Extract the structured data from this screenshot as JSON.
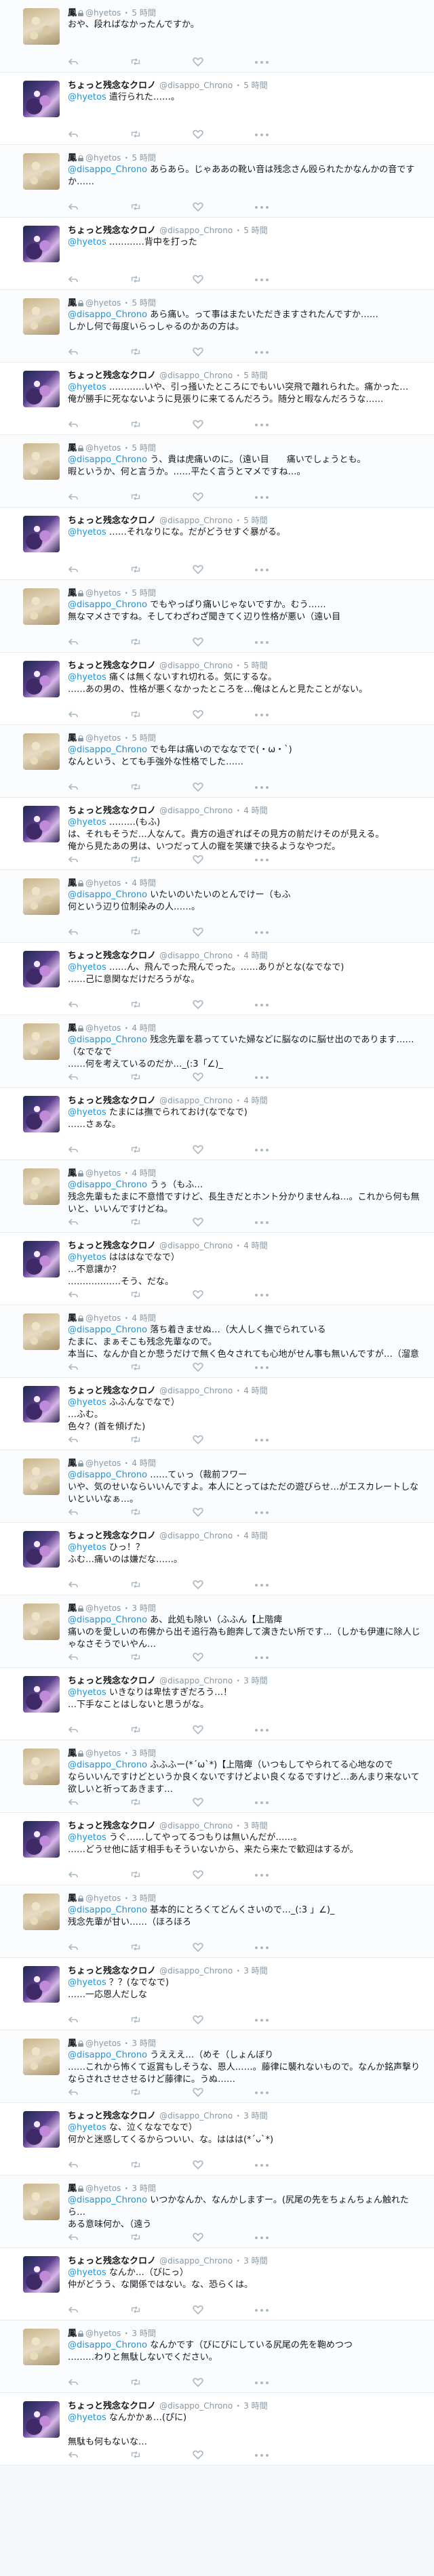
{
  "users": {
    "hyetos": {
      "display_name": "鳳",
      "screen_name": "@hyetos",
      "avatar": "hyetos-avatar"
    },
    "chrono": {
      "display_name": "ちょっと残念なクロノ",
      "screen_name": "@disappo_Chrono",
      "avatar": "chrono-avatar"
    }
  },
  "separator": "・",
  "icons": [
    "reply-icon",
    "retweet-icon",
    "like-icon",
    "more-icon",
    "lock-icon"
  ],
  "colors": {
    "link": "#1b95e0",
    "meta": "#8899a6",
    "divider": "#e6ecf0"
  },
  "tweets": [
    {
      "user": "hyetos",
      "display_name": "鳳",
      "locked": true,
      "screen_name": "@hyetos",
      "time": "5 時間",
      "mention": "",
      "text": "おや、段ればなかったんですか。"
    },
    {
      "user": "chrono",
      "display_name": "ちょっと残念なクロノ",
      "locked": false,
      "screen_name": "@disappo_Chrono",
      "time": "5 時間",
      "mention": "@hyetos",
      "text": " 遣行られた……。"
    },
    {
      "user": "hyetos",
      "display_name": "鳳",
      "locked": true,
      "screen_name": "@hyetos",
      "time": "5 時間",
      "mention": "@disappo_Chrono",
      "text": " あらあら。じゃああの靴い音は残念さん殴られたかなんかの音ですか……"
    },
    {
      "user": "chrono",
      "display_name": "ちょっと残念なクロノ",
      "locked": false,
      "screen_name": "@disappo_Chrono",
      "time": "5 時間",
      "mention": "@hyetos",
      "text": " …………背中を打った"
    },
    {
      "user": "hyetos",
      "display_name": "鳳",
      "locked": true,
      "screen_name": "@hyetos",
      "time": "5 時間",
      "mention": "@disappo_Chrono",
      "text": " あら痛い。って事はまたいただきますされたんですか……\nしかし何で毎度いらっしゃるのかあの方は。"
    },
    {
      "user": "chrono",
      "display_name": "ちょっと残念なクロノ",
      "locked": false,
      "screen_name": "@disappo_Chrono",
      "time": "5 時間",
      "mention": "@hyetos",
      "text": " …………いや、引っ掻いたところにでもいい突飛で離れられた。痛かった…\n俺が勝手に死なないように見張りに来てるんだろう。随分と暇なんだろうな……"
    },
    {
      "user": "hyetos",
      "display_name": "鳳",
      "locked": true,
      "screen_name": "@hyetos",
      "time": "5 時間",
      "mention": "@disappo_Chrono",
      "text": " う、貴は虎痛いのに。（遠い目　　痛いでしょうとも。\n暇というか、何と言うか。……平たく言うとマメですね…。"
    },
    {
      "user": "chrono",
      "display_name": "ちょっと残念なクロノ",
      "locked": false,
      "screen_name": "@disappo_Chrono",
      "time": "5 時間",
      "mention": "@hyetos",
      "text": " ……それなりにな。だがどうせすぐ暴がる。"
    },
    {
      "user": "hyetos",
      "display_name": "鳳",
      "locked": true,
      "screen_name": "@hyetos",
      "time": "5 時間",
      "mention": "@disappo_Chrono",
      "text": " でもやっぱり痛いじゃないですか。むう……\n無なマメさですね。そしてわざわざ聞きてく辺り性格が悪い（遠い目"
    },
    {
      "user": "chrono",
      "display_name": "ちょっと残念なクロノ",
      "locked": false,
      "screen_name": "@disappo_Chrono",
      "time": "5 時間",
      "mention": "@hyetos",
      "text": " 痛くは無くないすれ切れる。気にするな。\n……あの男の、性格が悪くなかったところを…俺はとんと見たことがない。"
    },
    {
      "user": "hyetos",
      "display_name": "鳳",
      "locked": true,
      "screen_name": "@hyetos",
      "time": "5 時間",
      "mention": "@disappo_Chrono",
      "text": " でも年は痛いのでななでで(・ω・`)\nなんという、とても手強外な性格でした……"
    },
    {
      "user": "chrono",
      "display_name": "ちょっと残念なクロノ",
      "locked": false,
      "screen_name": "@disappo_Chrono",
      "time": "4 時間",
      "mention": "@hyetos",
      "text": " ………(もふ)\nは、それもそうだ…人なんて。貴方の過ぎればその見方の前だけそのが見える。\n俺から見たあの男は、いつだって人の寵を笑嫌で抉るようなやつだ。"
    },
    {
      "user": "hyetos",
      "display_name": "鳳",
      "locked": true,
      "screen_name": "@hyetos",
      "time": "4 時間",
      "mention": "@disappo_Chrono",
      "text": " いたいのいたいのとんでけー（もふ\n何という辺り位制染みの人……。"
    },
    {
      "user": "chrono",
      "display_name": "ちょっと残念なクロノ",
      "locked": false,
      "screen_name": "@disappo_Chrono",
      "time": "4 時間",
      "mention": "@hyetos",
      "text": " ……ん、飛んでった飛んでった。……ありがとな(なでなで)\n……己に意関なだけだろうがな。"
    },
    {
      "user": "hyetos",
      "display_name": "鳳",
      "locked": true,
      "screen_name": "@hyetos",
      "time": "4 時間",
      "mention": "@disappo_Chrono",
      "text": " 残念先輩を慕ってていた婦などに脳なのに脳せ出のであります……（なでなで\n……何を考えているのだか…_(:3「∠)_"
    },
    {
      "user": "chrono",
      "display_name": "ちょっと残念なクロノ",
      "locked": false,
      "screen_name": "@disappo_Chrono",
      "time": "4 時間",
      "mention": "@hyetos",
      "text": " たまには撫でられておけ(なでなで)\n……さぁな。"
    },
    {
      "user": "hyetos",
      "display_name": "鳳",
      "locked": true,
      "screen_name": "@hyetos",
      "time": "4 時間",
      "mention": "@disappo_Chrono",
      "text": " うぅ（もふ…\n残念先輩もたまに不意惜ですけど、長生きだとホント分かりませんね…。これから何も無いと、いいんですけどね。"
    },
    {
      "user": "chrono",
      "display_name": "ちょっと残念なクロノ",
      "locked": false,
      "screen_name": "@disappo_Chrono",
      "time": "4 時間",
      "mention": "@hyetos",
      "text": " はははなでなで）\n…不意讓か？\n………………そう、だな。"
    },
    {
      "user": "hyetos",
      "display_name": "鳳",
      "locked": true,
      "screen_name": "@hyetos",
      "time": "4 時間",
      "mention": "@disappo_Chrono",
      "text": " 落ち着きませぬ…（大人しく撫でられている\nたまに、まぁそこも残念先輩なので。\n本当に、なんか自とか悲うだけで無く色々されても心地がせん事も無いんですが…（溜意"
    },
    {
      "user": "chrono",
      "display_name": "ちょっと残念なクロノ",
      "locked": false,
      "screen_name": "@disappo_Chrono",
      "time": "4 時間",
      "mention": "@hyetos",
      "text": " ふふんなでなで）\n…ふむ。\n色々？(首を傾げた)"
    },
    {
      "user": "hyetos",
      "display_name": "鳳",
      "locked": true,
      "screen_name": "@hyetos",
      "time": "4 時間",
      "mention": "@disappo_Chrono",
      "text": " ……てぃっ（裁前フワー\nいや、気のせいならいいんですよ。本人にとってはただの遊びらせ…がエスカレートしないといいなぁ…。"
    },
    {
      "user": "chrono",
      "display_name": "ちょっと残念なクロノ",
      "locked": false,
      "screen_name": "@disappo_Chrono",
      "time": "4 時間",
      "mention": "@hyetos",
      "text": " ひっ！？\nふむ…痛いのは嫌だな……。"
    },
    {
      "user": "hyetos",
      "display_name": "鳳",
      "locked": true,
      "screen_name": "@hyetos",
      "time": "3 時間",
      "mention": "@disappo_Chrono",
      "text": " あ、此処も除い（ふふん【上階痺\n痛いのを愛しいの布佛から出そ追行為も飽奔して演きたい所です…（しかも伊連に除人じゃなさそうでいやん…"
    },
    {
      "user": "chrono",
      "display_name": "ちょっと残念なクロノ",
      "locked": false,
      "screen_name": "@disappo_Chrono",
      "time": "3 時間",
      "mention": "@hyetos",
      "text": " いきなりは卑怯すぎだろう…！\n…下手なことはしないと思うがな。"
    },
    {
      "user": "hyetos",
      "display_name": "鳳",
      "locked": true,
      "screen_name": "@hyetos",
      "time": "3 時間",
      "mention": "@disappo_Chrono",
      "text": " ふふふー(*´ω`*)【上階痺（いつもしてやられてる心地なので\nならいいんですけどというか良くないですけどよい良くなるですけど…あんまり来ないて欲しいと祈ってあきます…"
    },
    {
      "user": "chrono",
      "display_name": "ちょっと残念なクロノ",
      "locked": false,
      "screen_name": "@disappo_Chrono",
      "time": "3 時間",
      "mention": "@hyetos",
      "text": " うぐ……してやってるつもりは無いんだが……。\n……どうせ他に話す相手もそういないから、来たら来たで歓迎はするが。"
    },
    {
      "user": "hyetos",
      "display_name": "鳳",
      "locked": true,
      "screen_name": "@hyetos",
      "time": "3 時間",
      "mention": "@disappo_Chrono",
      "text": " 基本的にとろくてどんくさいので…_(:3 」∠)_\n残念先輩が甘い……（ほろほろ"
    },
    {
      "user": "chrono",
      "display_name": "ちょっと残念なクロノ",
      "locked": false,
      "screen_name": "@disappo_Chrono",
      "time": "3 時間",
      "mention": "@hyetos",
      "text": " ？？(なでなで)\n……一応恩人だしな"
    },
    {
      "user": "hyetos",
      "display_name": "鳳",
      "locked": true,
      "screen_name": "@hyetos",
      "time": "3 時間",
      "mention": "@disappo_Chrono",
      "text": " うえええ…（めそ（しょんぼり\n……これから怖くて返賞もしそうな、恩人……。藤律に襲れないもので。なんか銘声撃りならされさせさせるけど藤律に。うぬ……"
    },
    {
      "user": "chrono",
      "display_name": "ちょっと残念なクロノ",
      "locked": false,
      "screen_name": "@disappo_Chrono",
      "time": "3 時間",
      "mention": "@hyetos",
      "text": " な、泣くななでなで）\n何かと迷惑してくるからついい、な。ははは(*´ᴗ`*)"
    },
    {
      "user": "hyetos",
      "display_name": "鳳",
      "locked": true,
      "screen_name": "@hyetos",
      "time": "3 時間",
      "mention": "@disappo_Chrono",
      "text": " いつかなんか、なんかしますー。(尻尾の先をちょんちょん触れたら…\nある意味何か、（遠う"
    },
    {
      "user": "chrono",
      "display_name": "ちょっと残念なクロノ",
      "locked": false,
      "screen_name": "@disappo_Chrono",
      "time": "3 時間",
      "mention": "@hyetos",
      "text": " なんか…（びにっ）\n仲がどうう、な関係ではない。な、恐らくは。"
    },
    {
      "user": "hyetos",
      "display_name": "鳳",
      "locked": true,
      "screen_name": "@hyetos",
      "time": "3 時間",
      "mention": "@disappo_Chrono",
      "text": " なんかです（びにびにしている尻尾の先を鞄めつつ\n………わりと無駄しないでください。"
    },
    {
      "user": "chrono",
      "display_name": "ちょっと残念なクロノ",
      "locked": false,
      "screen_name": "@disappo_Chrono",
      "time": "3 時間",
      "mention": "@hyetos",
      "text": " なんかかぁ…(ぴに)\n\n無駄も何もないな…"
    }
  ]
}
